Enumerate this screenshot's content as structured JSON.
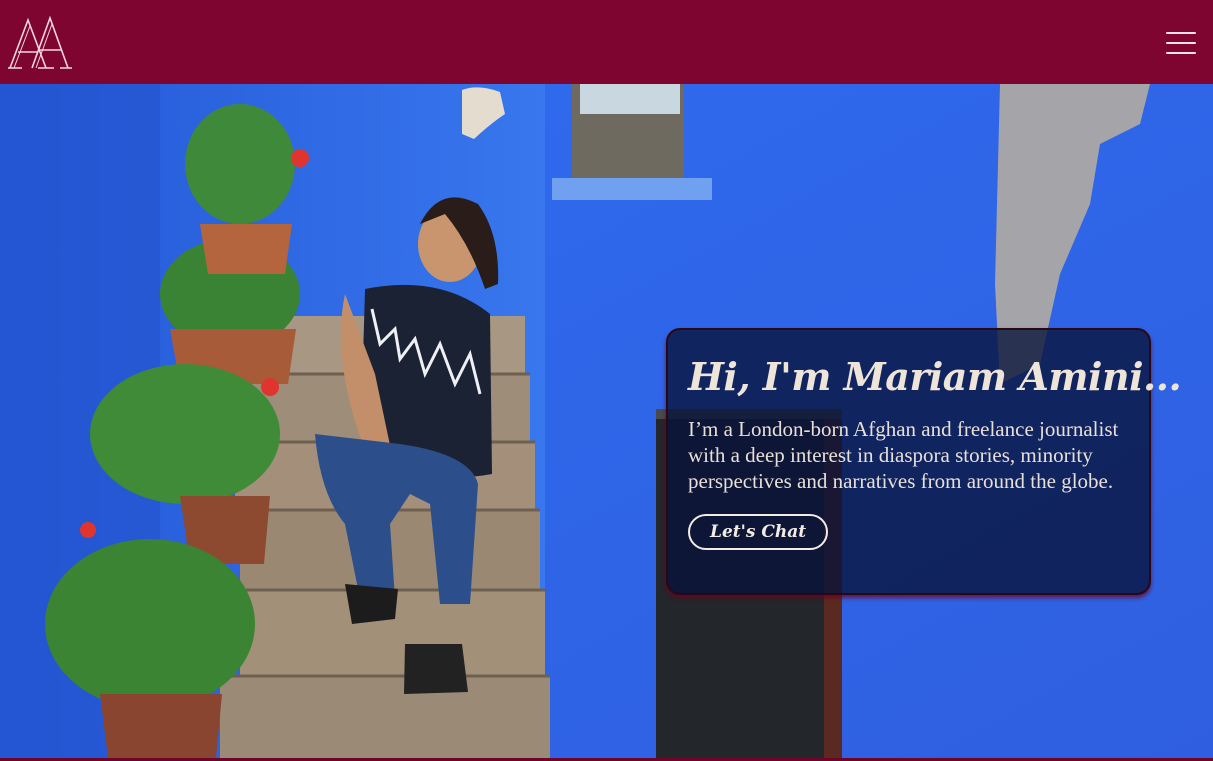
{
  "header": {
    "logo_text": "AA",
    "menu_icon": "hamburger-menu-icon"
  },
  "hero": {
    "image_alt": "",
    "title": "Hi, I'm Mariam Amini...",
    "description": "I’m a London-born Afghan and freelance journalist with a deep interest in diaspora stories, minority perspectives and narratives from around the globe.",
    "cta_label": "Let's Chat"
  },
  "colors": {
    "brand": "#7e0530",
    "wall": "#2f6ee8",
    "card_bg": "#08123a",
    "text_light": "#efe4d8"
  }
}
